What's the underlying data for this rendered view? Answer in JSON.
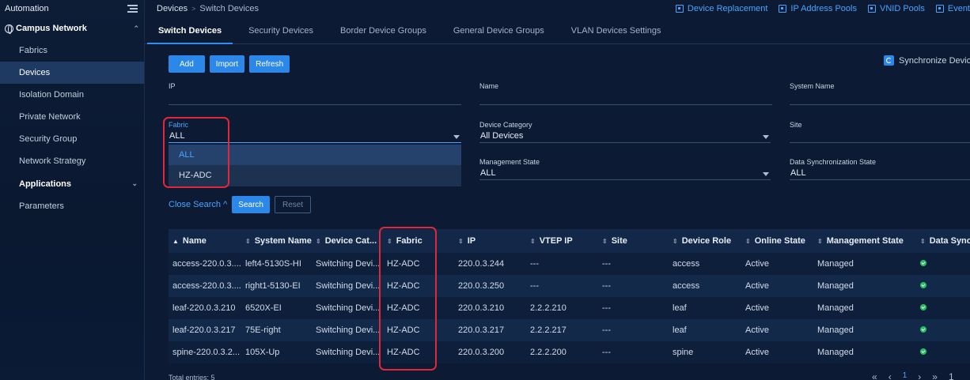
{
  "sidebar": {
    "title": "Automation",
    "group": "Campus Network",
    "items": [
      {
        "label": "Fabrics"
      },
      {
        "label": "Devices"
      },
      {
        "label": "Isolation Domain"
      },
      {
        "label": "Private Network"
      },
      {
        "label": "Security Group"
      },
      {
        "label": "Network Strategy"
      }
    ],
    "applications": "Applications",
    "parameters": "Parameters"
  },
  "header": {
    "breadcrumb": {
      "root": "Devices",
      "sep": ">",
      "current": "Switch Devices"
    },
    "links": [
      {
        "label": "Device Replacement"
      },
      {
        "label": "IP Address Pools"
      },
      {
        "label": "VNID Pools"
      },
      {
        "label": "Event"
      }
    ]
  },
  "tabs": [
    {
      "label": "Switch Devices"
    },
    {
      "label": "Security Devices"
    },
    {
      "label": "Border Device Groups"
    },
    {
      "label": "General Device Groups"
    },
    {
      "label": "VLAN Devices Settings"
    }
  ],
  "actions": {
    "add": "Add",
    "import": "Import",
    "refresh": "Refresh",
    "sync": "Synchronize Device"
  },
  "filters": {
    "ip": {
      "label": "IP",
      "value": ""
    },
    "name": {
      "label": "Name",
      "value": ""
    },
    "system_name": {
      "label": "System Name",
      "value": ""
    },
    "fabric": {
      "label": "Fabric",
      "value": "ALL",
      "options": [
        "ALL",
        "HZ-ADC"
      ]
    },
    "device_category": {
      "label": "Device Category",
      "value": "All Devices"
    },
    "site": {
      "label": "Site",
      "value": ""
    },
    "management_state": {
      "label": "Management State",
      "value": "ALL"
    },
    "data_sync_state": {
      "label": "Data Synchronization State",
      "value": "ALL"
    }
  },
  "search": {
    "close": "Close Search",
    "caret": "^",
    "search": "Search",
    "reset": "Reset"
  },
  "table": {
    "headers": [
      "Name",
      "System Name",
      "Device Cat...",
      "Fabric",
      "IP",
      "VTEP IP",
      "Site",
      "Device Role",
      "Online State",
      "Management State",
      "Data Sync"
    ],
    "rows": [
      [
        "access-220.0.3....",
        "left4-5130S-HI",
        "Switching Devi...",
        "HZ-ADC",
        "220.0.3.244",
        "---",
        "---",
        "access",
        "Active",
        "Managed"
      ],
      [
        "access-220.0.3....",
        "right1-5130-EI",
        "Switching Devi...",
        "HZ-ADC",
        "220.0.3.250",
        "---",
        "---",
        "access",
        "Active",
        "Managed"
      ],
      [
        "leaf-220.0.3.210",
        "6520X-EI",
        "Switching Devi...",
        "HZ-ADC",
        "220.0.3.210",
        "2.2.2.210",
        "---",
        "leaf",
        "Active",
        "Managed"
      ],
      [
        "leaf-220.0.3.217",
        "75E-right",
        "Switching Devi...",
        "HZ-ADC",
        "220.0.3.217",
        "2.2.2.217",
        "---",
        "leaf",
        "Active",
        "Managed"
      ],
      [
        "spine-220.0.3.2...",
        "105X-Up",
        "Switching Devi...",
        "HZ-ADC",
        "220.0.3.200",
        "2.2.2.200",
        "---",
        "spine",
        "Active",
        "Managed"
      ]
    ]
  },
  "footer": {
    "total": "Total entries: 5"
  },
  "pager": {
    "first": "«",
    "prev": "‹",
    "page": "1",
    "next": "›",
    "last": "»",
    "more": "1"
  }
}
